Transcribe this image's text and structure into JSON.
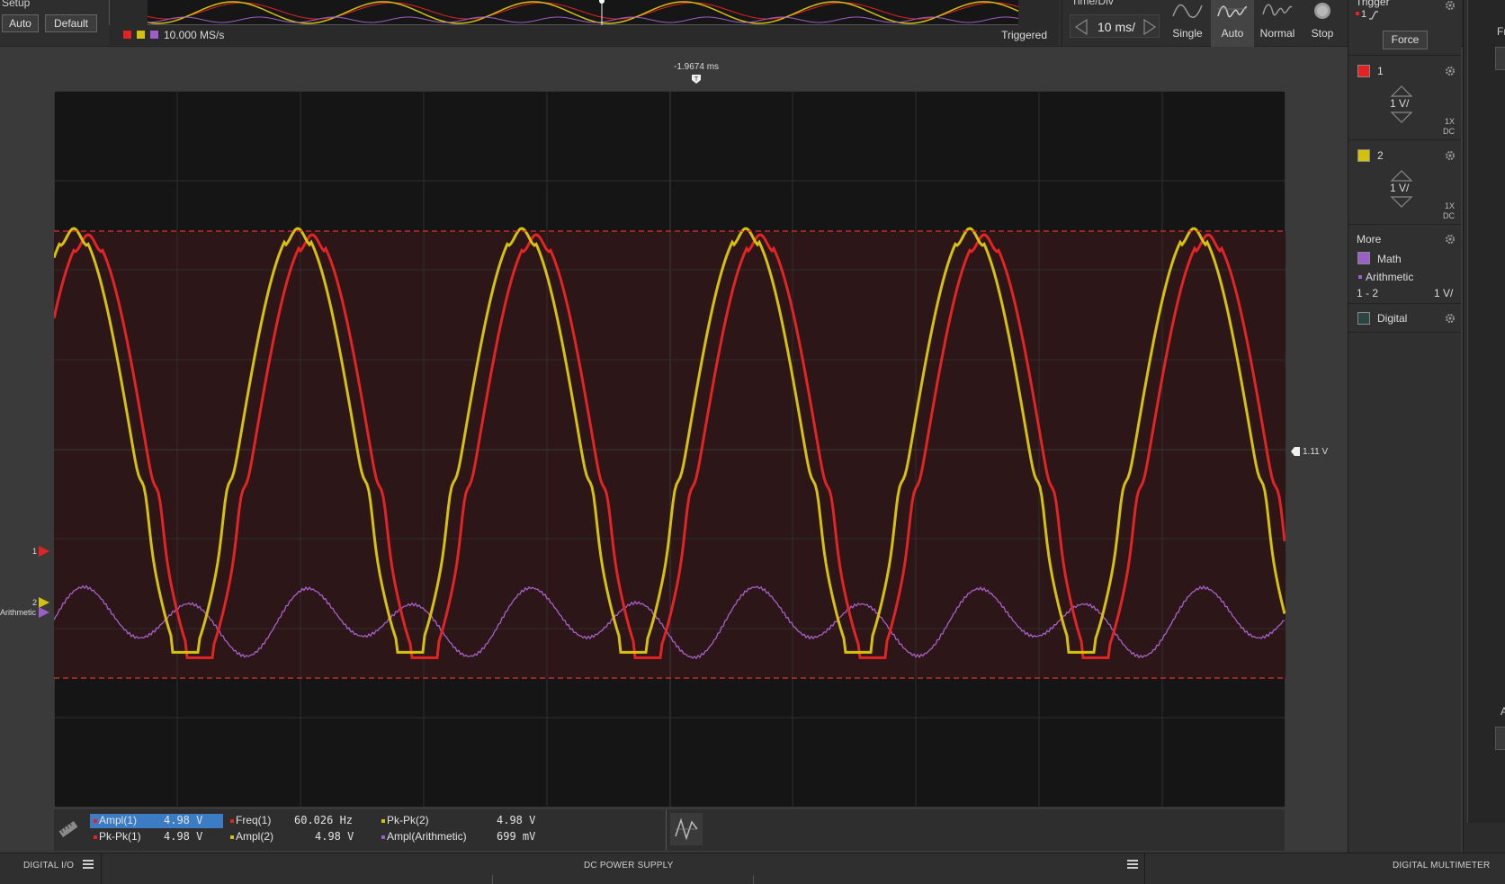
{
  "toolbar": {
    "setup_label": "Setup",
    "auto_label": "Auto",
    "default_label": "Default",
    "sample_rate": "10.000 MS/s",
    "trigger_status": "Triggered",
    "timediv_label": "Time/Div",
    "timediv_value": "10 ms/",
    "modes": {
      "single": "Single",
      "auto": "Auto",
      "normal": "Normal",
      "stop": "Stop"
    },
    "selected_mode": "Auto"
  },
  "right_panel": {
    "trigger_label": "Trigger",
    "trigger_source": "1",
    "force_label": "Force",
    "channel1": {
      "name": "1",
      "scale": "1 V/",
      "probe": "1X",
      "coupling": "DC",
      "color": "#e52222"
    },
    "channel2": {
      "name": "2",
      "scale": "1 V/",
      "probe": "1X",
      "coupling": "DC",
      "color": "#d4c10e"
    },
    "more_label": "More",
    "math": {
      "label": "Math",
      "type": "Arithmetic",
      "expr": "1 - 2",
      "scale": "1 V/",
      "color": "#9b5fc9"
    },
    "digital_label": "Digital"
  },
  "scope": {
    "trigger_time": "-1.9674 ms",
    "trigger_level": "1.11 V",
    "ch1_marker": "1",
    "ch2_marker": "2",
    "math_marker": "Arithmetic"
  },
  "measurements": {
    "col1": [
      {
        "name": "Ampl(1)",
        "value": "4.98  V",
        "color": "#e52222"
      },
      {
        "name": "Pk-Pk(1)",
        "value": "4.98  V",
        "color": "#e52222"
      }
    ],
    "col2": [
      {
        "name": "Freq(1)",
        "value": "60.026 Hz",
        "color": "#e52222"
      },
      {
        "name": "Ampl(2)",
        "value": "4.98  V",
        "color": "#d4c10e"
      }
    ],
    "col3": [
      {
        "name": "Pk-Pk(2)",
        "value": "4.98  V",
        "color": "#d4c10e"
      },
      {
        "name": "Ampl(Arithmetic)",
        "value": "699  mV",
        "color": "#9b5fc9"
      }
    ]
  },
  "bottom": {
    "digital_io": "DIGITAL I/O",
    "dc_power": "DC POWER SUPPLY",
    "dmm": "DIGITAL MULTIMETER"
  },
  "far_right": {
    "label1": "Fr",
    "label2": "A"
  }
}
